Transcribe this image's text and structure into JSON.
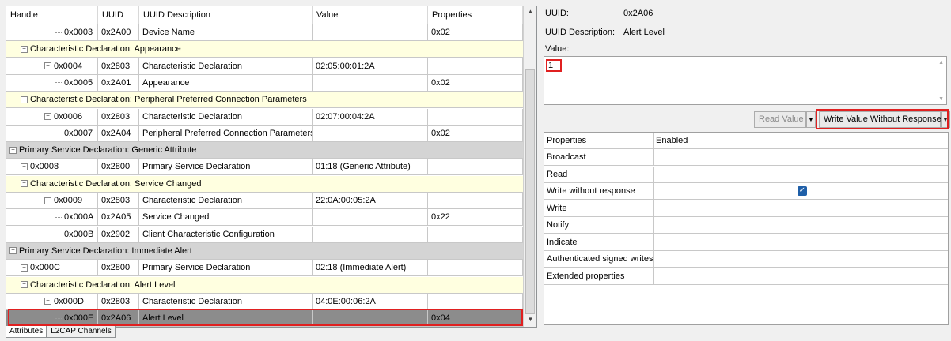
{
  "attributes": {
    "columns": [
      "Handle",
      "UUID",
      "UUID Description",
      "Value",
      "Properties"
    ],
    "rows": [
      {
        "kind": "attr",
        "handle": "0x0003",
        "uuid": "0x2A00",
        "desc": "Device Name",
        "value": "",
        "props": "0x02"
      },
      {
        "kind": "char",
        "label": "Characteristic Declaration: Appearance"
      },
      {
        "kind": "attr",
        "handle": "0x0004",
        "uuid": "0x2803",
        "desc": "Characteristic Declaration",
        "value": "02:05:00:01:2A",
        "props": ""
      },
      {
        "kind": "attr",
        "handle": "0x0005",
        "uuid": "0x2A01",
        "desc": "Appearance",
        "value": "",
        "props": "0x02"
      },
      {
        "kind": "char",
        "label": "Characteristic Declaration: Peripheral Preferred Connection Parameters"
      },
      {
        "kind": "attr",
        "handle": "0x0006",
        "uuid": "0x2803",
        "desc": "Characteristic Declaration",
        "value": "02:07:00:04:2A",
        "props": ""
      },
      {
        "kind": "attr",
        "handle": "0x0007",
        "uuid": "0x2A04",
        "desc": "Peripheral Preferred Connection Parameters",
        "value": "",
        "props": "0x02"
      },
      {
        "kind": "svc",
        "label": "Primary Service Declaration: Generic Attribute"
      },
      {
        "kind": "attr",
        "handle": "0x0008",
        "uuid": "0x2800",
        "desc": "Primary Service Declaration",
        "value": "01:18 (Generic Attribute)",
        "props": ""
      },
      {
        "kind": "char",
        "label": "Characteristic Declaration: Service Changed"
      },
      {
        "kind": "attr",
        "handle": "0x0009",
        "uuid": "0x2803",
        "desc": "Characteristic Declaration",
        "value": "22:0A:00:05:2A",
        "props": ""
      },
      {
        "kind": "attr",
        "handle": "0x000A",
        "uuid": "0x2A05",
        "desc": "Service Changed",
        "value": "",
        "props": "0x22"
      },
      {
        "kind": "attr",
        "handle": "0x000B",
        "uuid": "0x2902",
        "desc": "Client Characteristic Configuration",
        "value": "",
        "props": ""
      },
      {
        "kind": "svc",
        "label": "Primary Service Declaration: Immediate Alert"
      },
      {
        "kind": "attr",
        "handle": "0x000C",
        "uuid": "0x2800",
        "desc": "Primary Service Declaration",
        "value": "02:18 (Immediate Alert)",
        "props": ""
      },
      {
        "kind": "char",
        "label": "Characteristic Declaration: Alert Level"
      },
      {
        "kind": "attr",
        "handle": "0x000D",
        "uuid": "0x2803",
        "desc": "Characteristic Declaration",
        "value": "04:0E:00:06:2A",
        "props": ""
      },
      {
        "kind": "attr",
        "handle": "0x000E",
        "uuid": "0x2A06",
        "desc": "Alert Level",
        "value": "",
        "props": "0x04",
        "selected": true
      }
    ]
  },
  "tabs": [
    "Attributes",
    "L2CAP Channels"
  ],
  "detail": {
    "uuid_label": "UUID:",
    "uuid_value": "0x2A06",
    "desc_label": "UUID Description:",
    "desc_value": "Alert Level",
    "value_label": "Value:",
    "value_text": "1",
    "read_button": "Read Value",
    "write_button": "Write Value Without Response"
  },
  "properties": {
    "columns": [
      "Properties",
      "Enabled"
    ],
    "rows": [
      {
        "name": "Broadcast",
        "enabled": false
      },
      {
        "name": "Read",
        "enabled": false
      },
      {
        "name": "Write without response",
        "enabled": true
      },
      {
        "name": "Write",
        "enabled": false
      },
      {
        "name": "Notify",
        "enabled": false
      },
      {
        "name": "Indicate",
        "enabled": false
      },
      {
        "name": "Authenticated signed writes",
        "enabled": false
      },
      {
        "name": "Extended properties",
        "enabled": false
      }
    ]
  },
  "colors": {
    "service_bg": "#d4d4d4",
    "characteristic_bg": "#ffffe0",
    "selected_bg": "#8c8c8c",
    "highlight": "#e02020",
    "checkbox": "#1f5fa8"
  }
}
